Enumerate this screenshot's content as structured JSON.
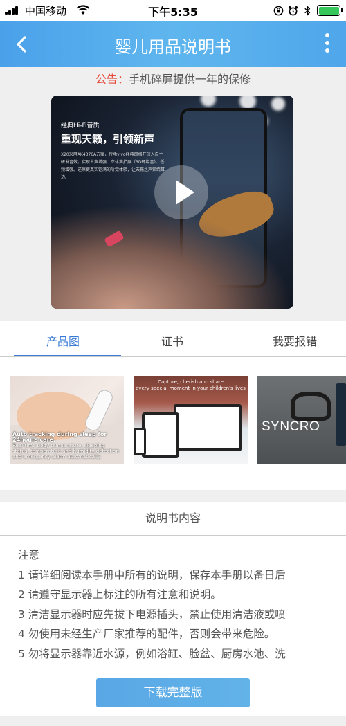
{
  "status_bar": {
    "carrier": "中国移动",
    "time": "下午5:35",
    "battery_level": 1.0
  },
  "nav": {
    "title": "婴儿用品说明书",
    "back_icon": "chevron-left-icon",
    "more_icon": "more-vertical-icon"
  },
  "notice": {
    "label": "公告：",
    "text": "手机碎屏提供一年的保修"
  },
  "video": {
    "brand": "经典Hi-Fi音质",
    "headline": "重现天籁，引领新声",
    "desc": "X20采用AK4376A方案，传承vivo经典风格开放入自主研发音效。实现人声增强、立体声扩展（3D环绕音）、低频增强。还原更真实饱满的听觉体验，让天籁之声萦绕耳边。",
    "play_icon": "play-icon"
  },
  "tabs": [
    {
      "label": "产品图",
      "active": true
    },
    {
      "label": "证书",
      "active": false
    },
    {
      "label": "我要报错",
      "active": false
    }
  ],
  "gallery": {
    "t1_caption_title": "Auto tracking during sleep for 24hours care.",
    "t1_caption_text": "Real-time body temperature, sleeping status, temperature and humidity detection and emergency alarm automatically.",
    "t2_header_1": "Capture, cherish and share",
    "t2_header_2": "every special moment in your children's lives",
    "t3_label": "SYNCRO"
  },
  "manual": {
    "title": "说明书内容",
    "lines": [
      "注意",
      "1  请详细阅读本手册中所有的说明，保存本手册以备日后",
      "2  请遵守显示器上标注的所有注意和说明。",
      "3  清洁显示器时应先拔下电源插头，禁止使用清洁液或喷",
      "4  勿使用未经生产厂家推荐的配件，否则会带来危险。",
      "5  勿将显示器靠近水源，例如浴缸、脸盆、厨房水池、洗"
    ],
    "download_label": "下载完整版"
  },
  "colors": {
    "nav_blue": "#4aa1ea",
    "tab_active": "#3a7bd5",
    "notice_label": "#e64b3c",
    "battery": "#35c759"
  }
}
